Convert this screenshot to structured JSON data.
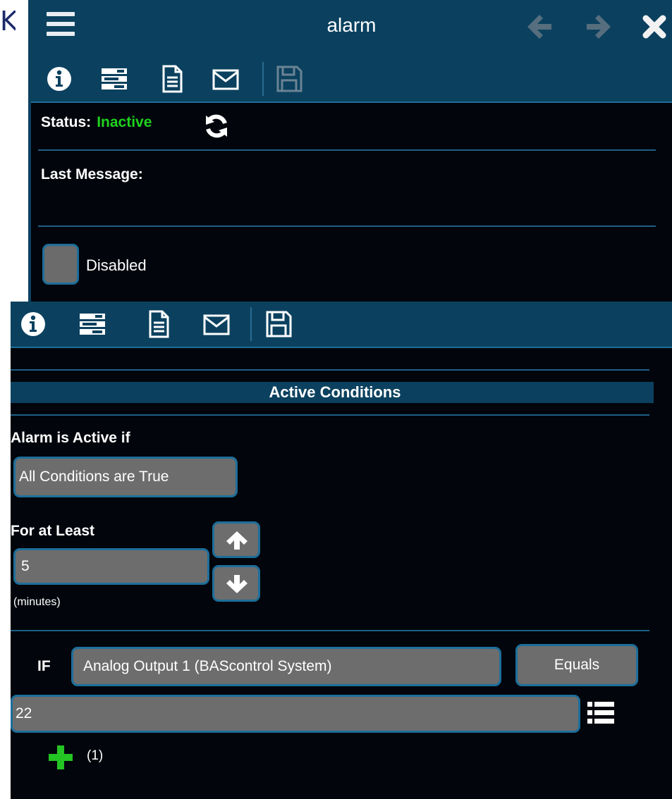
{
  "window": {
    "title": "alarm"
  },
  "status": {
    "label": "Status:",
    "value": "Inactive",
    "value_color": "#1fd21f"
  },
  "last_message": {
    "label": "Last Message:",
    "value": ""
  },
  "enable_toggle": {
    "label": "Disabled",
    "state": "off"
  },
  "toolbar_icons": [
    "info-icon",
    "server-icon",
    "document-icon",
    "envelope-icon",
    "save-icon"
  ],
  "active_conditions": {
    "section_title": "Active Conditions",
    "mode_label": "Alarm is Active if",
    "mode_value": "All Conditions are True",
    "duration_label": "For at Least",
    "duration_value": "5",
    "duration_unit": "(minutes)"
  },
  "condition": {
    "if_label": "IF",
    "object": "Analog Output 1 (BAScontrol System)",
    "operator": "Equals",
    "value": "22",
    "count_label": "(1)"
  },
  "colors": {
    "panel_bg": "#02060c",
    "header_bg": "#0b415f",
    "border_accent": "#1d6e9b",
    "control_bg": "#6d6d6d",
    "add_green": "#23c423"
  }
}
